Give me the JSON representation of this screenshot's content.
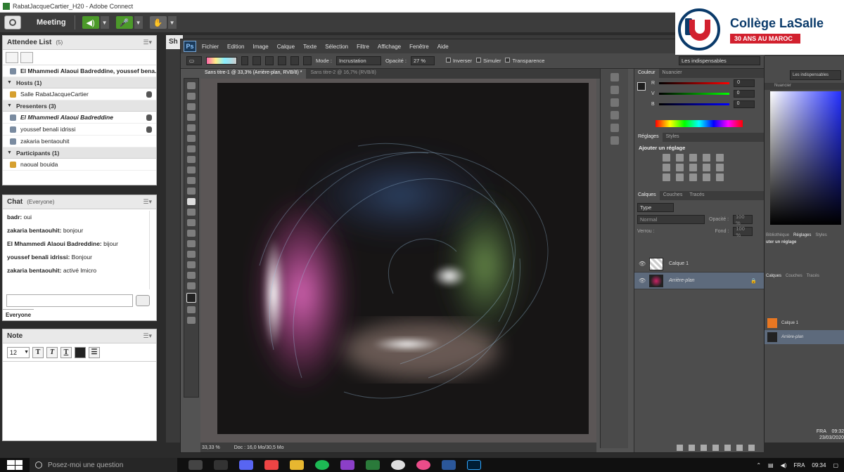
{
  "window": {
    "title": "RabatJacqueCartier_H20 - Adobe Connect"
  },
  "connect_menu": {
    "meeting_label": "Meeting"
  },
  "attendee_pod": {
    "title": "Attendee List",
    "count": "(5)",
    "speaking": "El Mhammedi Alaoui Badreddine, youssef bena...",
    "hosts_label": "Hosts (1)",
    "hosts": [
      "Salle RabatJacqueCartier"
    ],
    "presenters_label": "Presenters (3)",
    "presenters": [
      "El Mhammedi Alaoui Badreddine",
      "youssef benali idrissi",
      "zakaria bentaouhit"
    ],
    "participants_label": "Participants (1)",
    "participants": [
      "naoual bouida"
    ]
  },
  "chat_pod": {
    "title": "Chat",
    "scope": "(Everyone)",
    "messages": [
      {
        "from": "badr:",
        "text": " oui"
      },
      {
        "from": "zakaria bentaouhit:",
        "text": " bonjour"
      },
      {
        "from": "El Mhammedi Alaoui Badreddine:",
        "text": " bijour"
      },
      {
        "from": "youssef benali idrissi:",
        "text": " Bonjour"
      },
      {
        "from": "zakaria bentaouhit:",
        "text": " activé lmicro"
      }
    ],
    "tab_label": "Everyone"
  },
  "note_pod": {
    "title": "Note",
    "font_size": "12"
  },
  "share_pod": {
    "title": "Sh"
  },
  "photoshop": {
    "logo": "Ps",
    "menu": [
      "Fichier",
      "Edition",
      "Image",
      "Calque",
      "Texte",
      "Sélection",
      "Filtre",
      "Affichage",
      "Fenêtre",
      "Aide"
    ],
    "options": {
      "mode_label": "Mode :",
      "mode_value": "Incrustation",
      "opacity_label": "Opacité :",
      "opacity_value": "27 %",
      "invert_label": "Inverser",
      "simulate_label": "Simuler",
      "transparency_label": "Transparence",
      "workspace": "Les indispensables"
    },
    "tabs": [
      "Sans titre-1 @ 33,3% (Arrière-plan, RVB/8) *",
      "Sans titre-2 @ 16,7% (RVB/8)"
    ],
    "status": {
      "zoom": "33,33 %",
      "doc": "Doc : 16,0 Mo/30,5 Mo"
    },
    "color_panel": {
      "tabs": [
        "Couleur",
        "Nuancier"
      ],
      "channels": [
        {
          "name": "R",
          "value": "0"
        },
        {
          "name": "V",
          "value": "0"
        },
        {
          "name": "B",
          "value": "0"
        }
      ]
    },
    "adjust_panel": {
      "tabs": [
        "Réglages",
        "Styles"
      ],
      "heading": "Ajouter un réglage"
    },
    "layers_panel": {
      "tabs": [
        "Calques",
        "Couches",
        "Tracés"
      ],
      "kind": "Type",
      "blend": "Normal",
      "opacity_label": "Opacité :",
      "opacity_value": "100 %",
      "lock_label": "Verrou :",
      "fill_label": "Fond :",
      "fill_value": "100 %",
      "layers": [
        {
          "name": "Calque 1",
          "selected": false
        },
        {
          "name": "Arrière-plan",
          "selected": true
        }
      ]
    }
  },
  "ps_secondary": {
    "workspace": "Les indispensables",
    "tabs": [
      "Nuancier"
    ],
    "adjust_tabs": [
      "Bibliothèque",
      "Réglages",
      "Styles"
    ],
    "adjust_heading": "uter un réglage",
    "layers_tabs": [
      "Calques",
      "Couches",
      "Tracés"
    ],
    "layers": [
      "Calque 1",
      "Arrière-plan"
    ],
    "clock_time": "09:32",
    "clock_date": "23/03/2020",
    "lang": "FRA"
  },
  "logo": {
    "name": "Collège LaSalle",
    "tagline": "30 ANS AU MAROC"
  },
  "taskbar": {
    "search_placeholder": "Posez-moi une question",
    "lang": "FRA",
    "time": "09:34"
  },
  "colors": {
    "accent_blue": "#0a3a6a",
    "accent_red": "#d2202e",
    "ps_selected_layer": "#5d6a7c"
  }
}
